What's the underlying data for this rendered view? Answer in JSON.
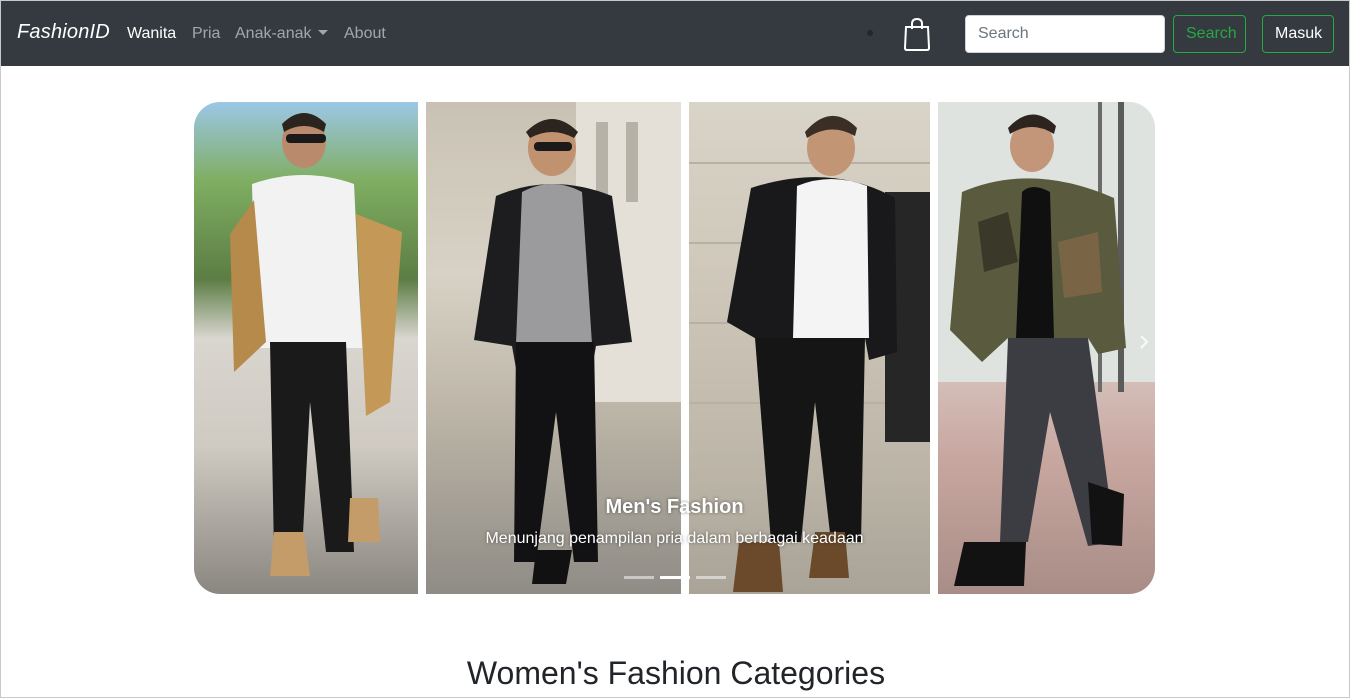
{
  "navbar": {
    "brand": "FashionID",
    "links": [
      {
        "label": "Wanita",
        "active": true
      },
      {
        "label": "Pria",
        "active": false
      },
      {
        "label": "Anak-anak",
        "active": false,
        "dropdown": true
      },
      {
        "label": "About",
        "active": false
      }
    ],
    "cart_icon": "shopping-bag-icon",
    "search": {
      "placeholder": "Search",
      "value": ""
    },
    "search_button": "Search",
    "login_button": "Masuk"
  },
  "carousel": {
    "slides": 3,
    "active_slide": 2,
    "caption": {
      "title": "Men's Fashion",
      "text": "Menunjang penampilan pria dalam berbagai keadaan"
    },
    "photos": [
      {
        "name": "man-white-tee-tan-jacket"
      },
      {
        "name": "man-grey-hoodie-leather-jacket"
      },
      {
        "name": "man-brooklyn-tee-denim-jacket"
      },
      {
        "name": "man-camo-jacket"
      }
    ]
  },
  "sections": {
    "categories_title": "Women's Fashion Categories"
  },
  "colors": {
    "navbar_bg": "#343a40",
    "success": "#28a745",
    "text_dark": "#212529"
  }
}
